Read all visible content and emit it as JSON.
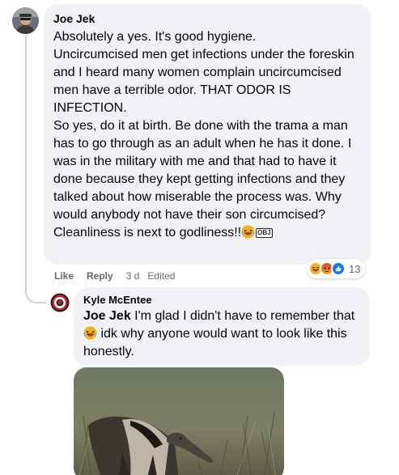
{
  "comment": {
    "author": "Joe Jek",
    "paragraphs": [
      "Absolutely a yes. It's good hygiene.",
      "Uncircumcised men get infections under the foreskin and I heard many women complain uncircumcised men have a terrible odor. THAT ODOR IS INFECTION.",
      "So yes, do it at birth. Be done with the trama a man has to go through as an adult when he has it done. I was in the military with me and that had to have it done because they kept getting infections and they talked about how miserable the process was. Why would anybody not have their son circumcised?"
    ],
    "last_line": "Cleanliness is next to godliness!!",
    "emoji_icon": "laughing-emoji-icon",
    "obj_badge": "OBJ",
    "reaction_icons": [
      "haha-reaction-icon",
      "angry-reaction-icon",
      "like-reaction-icon"
    ],
    "reaction_count": "13",
    "actions": {
      "like": "Like",
      "reply": "Reply",
      "time": "3 d",
      "edited": "Edited"
    }
  },
  "reply": {
    "author": "Kyle McEntee",
    "mention": "Joe Jek",
    "text_before_emoji": " I'm glad I didn't have to remember that ",
    "emoji_icon": "laughing-emoji-icon",
    "text_after_emoji": " idk why anyone would want to look like this honestly.",
    "photo": "anteater-photo"
  },
  "colors": {
    "bubble": "#f0f2f5",
    "secondary_text": "#65676b",
    "like_blue": "#1877f2",
    "angry_orange": "#e9710f",
    "haha_yellow": "#f7b125"
  }
}
